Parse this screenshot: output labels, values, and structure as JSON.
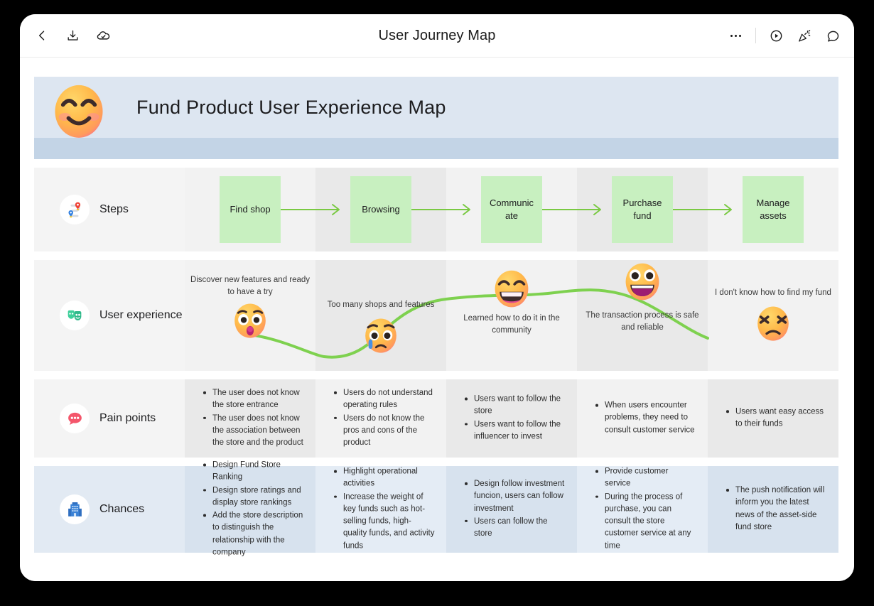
{
  "titlebar": {
    "title": "User Journey Map",
    "left_icons": [
      {
        "name": "back-chevron-icon",
        "label": "Back"
      },
      {
        "name": "download-icon",
        "label": "Download"
      },
      {
        "name": "cloud-synced-icon",
        "label": "Saved to cloud"
      }
    ],
    "right_icons": [
      {
        "name": "more-options-icon",
        "label": "More"
      },
      {
        "name": "present-icon",
        "label": "Present"
      },
      {
        "name": "celebrate-icon",
        "label": "Celebrate"
      },
      {
        "name": "comment-icon",
        "label": "Comment"
      }
    ]
  },
  "banner": {
    "emoji": "smiling-face-with-smiling-eyes",
    "title": "Fund Product User Experience Map",
    "bg_top": "#dde6f1",
    "bg_bottom": "#c3d4e6"
  },
  "rows": [
    {
      "id": "steps",
      "label": "Steps",
      "icon": "route-map-icon",
      "steps": [
        "Find shop",
        "Browsing",
        "Communic ate",
        "Purchase fund",
        "Manage assets"
      ],
      "box_color": "#c8f0c0",
      "arrow_color": "#7ac943"
    },
    {
      "id": "user-experience",
      "label": "User experience",
      "icon": "theater-masks-icon",
      "line_color": "#7ed14f",
      "nodes": [
        {
          "caption": "Discover new features and ready to have a try",
          "emoji": "face-with-open-mouth",
          "caption_position": "above"
        },
        {
          "caption": "Too many shops and features",
          "emoji": "crying-face",
          "caption_position": "above"
        },
        {
          "caption": "Learned how to do it in the community",
          "emoji": "grinning-squinting-face",
          "caption_position": "below"
        },
        {
          "caption": "The transaction process is safe and reliable",
          "emoji": "grinning-face-with-big-eyes",
          "caption_position": "below"
        },
        {
          "caption": "I don't know how to find my fund",
          "emoji": "confounded-face",
          "caption_position": "above"
        }
      ]
    },
    {
      "id": "pain-points",
      "label": "Pain points",
      "icon": "speech-bubble-icon",
      "columns": [
        [
          "The user does not know the store entrance",
          "The user does not know the association between the store and the product"
        ],
        [
          "Users do not understand operating rules",
          "Users do not know the pros and cons of the product"
        ],
        [
          "Users want to follow the store",
          "Users want to follow the influencer to invest"
        ],
        [
          "When users encounter problems, they need to consult customer service"
        ],
        [
          "Users want easy access to their funds"
        ]
      ]
    },
    {
      "id": "chances",
      "label": "Chances",
      "icon": "office-building-icon",
      "columns": [
        [
          "Design Fund Store Ranking",
          "Design store ratings and display store rankings",
          "Add the store description to distinguish the relationship with the company"
        ],
        [
          "Highlight operational activities",
          "Increase the weight of key funds such as hot-selling funds, high-quality funds, and activity funds"
        ],
        [
          "Design follow investment funcion, users can follow investment",
          "Users can follow the store"
        ],
        [
          "Provide customer service",
          "During the process of purchase, you can consult the store customer service at any time"
        ],
        [
          "The push notification will inform you the latest news of the asset-side fund store"
        ]
      ]
    }
  ]
}
